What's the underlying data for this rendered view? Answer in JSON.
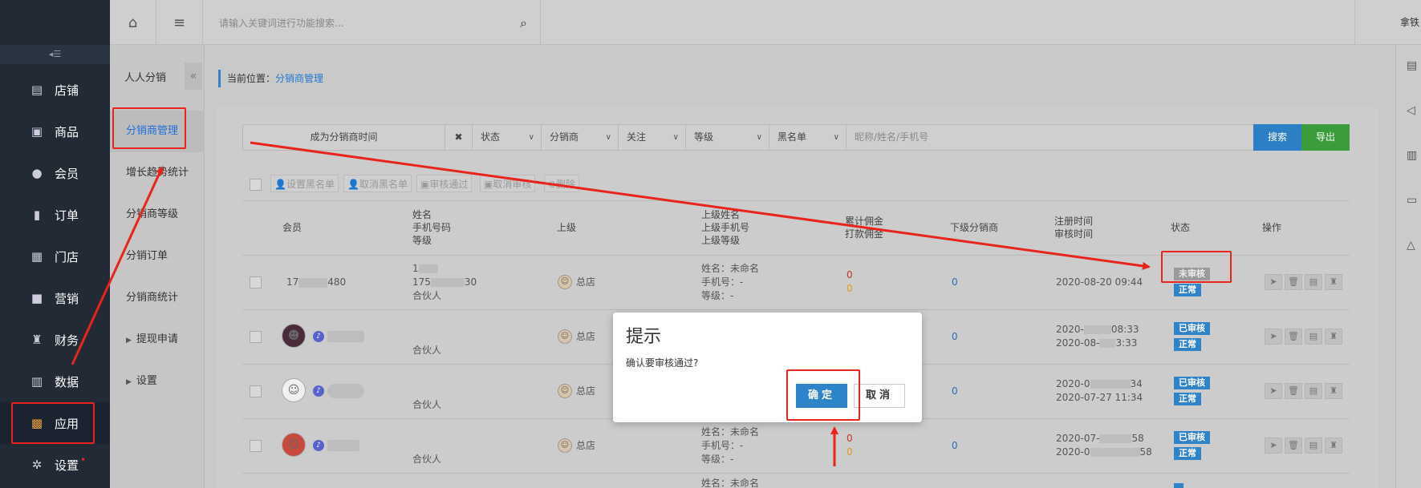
{
  "nav": {
    "toggle": "◂☰",
    "items": [
      {
        "label": "店铺",
        "icon": "▤"
      },
      {
        "label": "商品",
        "icon": "▣"
      },
      {
        "label": "会员",
        "icon": "●"
      },
      {
        "label": "订单",
        "icon": "▮"
      },
      {
        "label": "门店",
        "icon": "▦"
      },
      {
        "label": "营销",
        "icon": "■"
      },
      {
        "label": "财务",
        "icon": "♜"
      },
      {
        "label": "数据",
        "icon": "▥"
      },
      {
        "label": "应用",
        "icon": "▩"
      },
      {
        "label": "设置",
        "icon": "✲"
      }
    ],
    "settings_dot": "•"
  },
  "topbar": {
    "search_placeholder": "请输入关键词进行功能搜索...",
    "user": "拿铁"
  },
  "subnav": {
    "title": "人人分销",
    "collapse": "«",
    "items": [
      {
        "label": "分销商管理"
      },
      {
        "label": "增长趋势统计"
      },
      {
        "label": "分销商等级"
      },
      {
        "label": "分销订单"
      },
      {
        "label": "分销商统计"
      },
      {
        "label": "提现申请"
      },
      {
        "label": "设置"
      }
    ]
  },
  "breadcrumb": {
    "prefix": "当前位置：",
    "current": "分销商管理"
  },
  "filter": {
    "time": "成为分销商时间",
    "clear": "✖",
    "status": "状态",
    "distributor": "分销商",
    "follow": "关注",
    "level": "等级",
    "blacklist": "黑名单",
    "keyword_placeholder": "昵称/姓名/手机号",
    "search": "搜索",
    "export": "导出"
  },
  "actions": [
    "设置黑名单",
    "取消黑名单",
    "审核通过",
    "取消审核",
    "删除"
  ],
  "table": {
    "headers": {
      "member": "会员",
      "name": [
        "姓名",
        "手机号码",
        "等级"
      ],
      "superior": "上级",
      "superior_info": [
        "上级姓名",
        "上级手机号",
        "上级等级"
      ],
      "commission": [
        "累计佣金",
        "打款佣金"
      ],
      "sub": "下级分销商",
      "time": [
        "注册时间",
        "审核时间"
      ],
      "status": "状态",
      "ops": "操作"
    },
    "rows": [
      {
        "member": "17",
        "member2": "480",
        "name1": "1",
        "name2": "175",
        "name2b": "30",
        "name3": "合伙人",
        "superior": "总店",
        "sup1": "姓名：未命名",
        "sup2": "手机号：-",
        "sup3": "等级：-",
        "c1": "0",
        "c2": "0",
        "sub": "0",
        "t1": "2020-08-20 09:44",
        "t2": "",
        "s1": "未审核",
        "s2": "正常"
      },
      {
        "member": "",
        "name3": "合伙人",
        "superior": "总店",
        "sub": "0",
        "t1a": "2020-",
        "t1b": "08:33",
        "t2a": "2020-08-",
        "t2b": "3:33",
        "s1": "已审核",
        "s2": "正常"
      },
      {
        "member": "",
        "name3": "合伙人",
        "superior": "总店",
        "sub": "0",
        "t1a": "2020-0",
        "t1b": "34",
        "t2": "2020-07-27 11:34",
        "s1": "已审核",
        "s2": "正常"
      },
      {
        "member": "",
        "name3": "合伙人",
        "superior": "总店",
        "sup1": "姓名：未命名",
        "sup2": "手机号：-",
        "sup3": "等级：-",
        "c1": "0",
        "c2": "0",
        "sub": "0",
        "t1a": "2020-07-",
        "t1b": "58",
        "t2a": "2020-0",
        "t2b": "58",
        "s1": "已审核",
        "s2": "正常"
      }
    ],
    "partial_row": {
      "sup1": "姓名：未命名"
    }
  },
  "ops_icons": [
    "➤",
    "🗑",
    "▤",
    "♜"
  ],
  "modal": {
    "title": "提示",
    "message": "确认要审核通过?",
    "ok": "确定",
    "cancel": "取消"
  },
  "colors": {
    "annotation": "#e8241c",
    "primary": "#2f83c9",
    "export": "#3a9c3a"
  }
}
